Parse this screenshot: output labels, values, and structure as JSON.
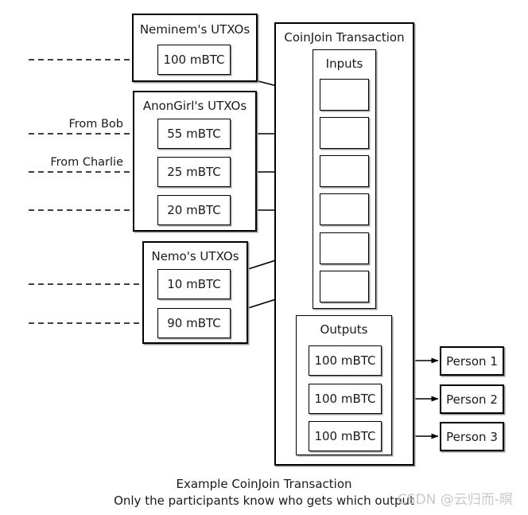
{
  "diagram": {
    "caption_line_1": "Example CoinJoin Transaction",
    "caption_line_2": "Only the participants know who gets which output",
    "watermark": "CSDN @云归而-暝"
  },
  "wallets": [
    {
      "id": "neminem",
      "title": "Neminem's UTXOs",
      "utxos": [
        {
          "amount": "100 mBTC"
        }
      ]
    },
    {
      "id": "anongirl",
      "title": "AnonGirl's UTXOs",
      "utxos": [
        {
          "amount": "55 mBTC"
        },
        {
          "amount": "25 mBTC"
        },
        {
          "amount": "20 mBTC"
        }
      ]
    },
    {
      "id": "nemo",
      "title": "Nemo's UTXOs",
      "utxos": [
        {
          "amount": "10 mBTC"
        },
        {
          "amount": "90 mBTC"
        }
      ]
    }
  ],
  "incoming_labels": [
    {
      "text": "From Bob"
    },
    {
      "text": "From Charlie"
    }
  ],
  "transaction": {
    "title": "CoinJoin Transaction",
    "inputs": {
      "title": "Inputs",
      "slots": [
        {
          "amount": ""
        },
        {
          "amount": ""
        },
        {
          "amount": ""
        },
        {
          "amount": ""
        },
        {
          "amount": ""
        },
        {
          "amount": ""
        }
      ]
    },
    "outputs": {
      "title": "Outputs",
      "entries": [
        {
          "amount": "100 mBTC"
        },
        {
          "amount": "100 mBTC"
        },
        {
          "amount": "100 mBTC"
        }
      ]
    }
  },
  "recipients": [
    {
      "name": "Person 1"
    },
    {
      "name": "Person 2"
    },
    {
      "name": "Person 3"
    }
  ],
  "colors": {
    "stroke": "#000000",
    "shadow": "#9a9a9a",
    "background": "#ffffff",
    "text": "#1a1a1a",
    "watermark": "#c9c9c9"
  }
}
